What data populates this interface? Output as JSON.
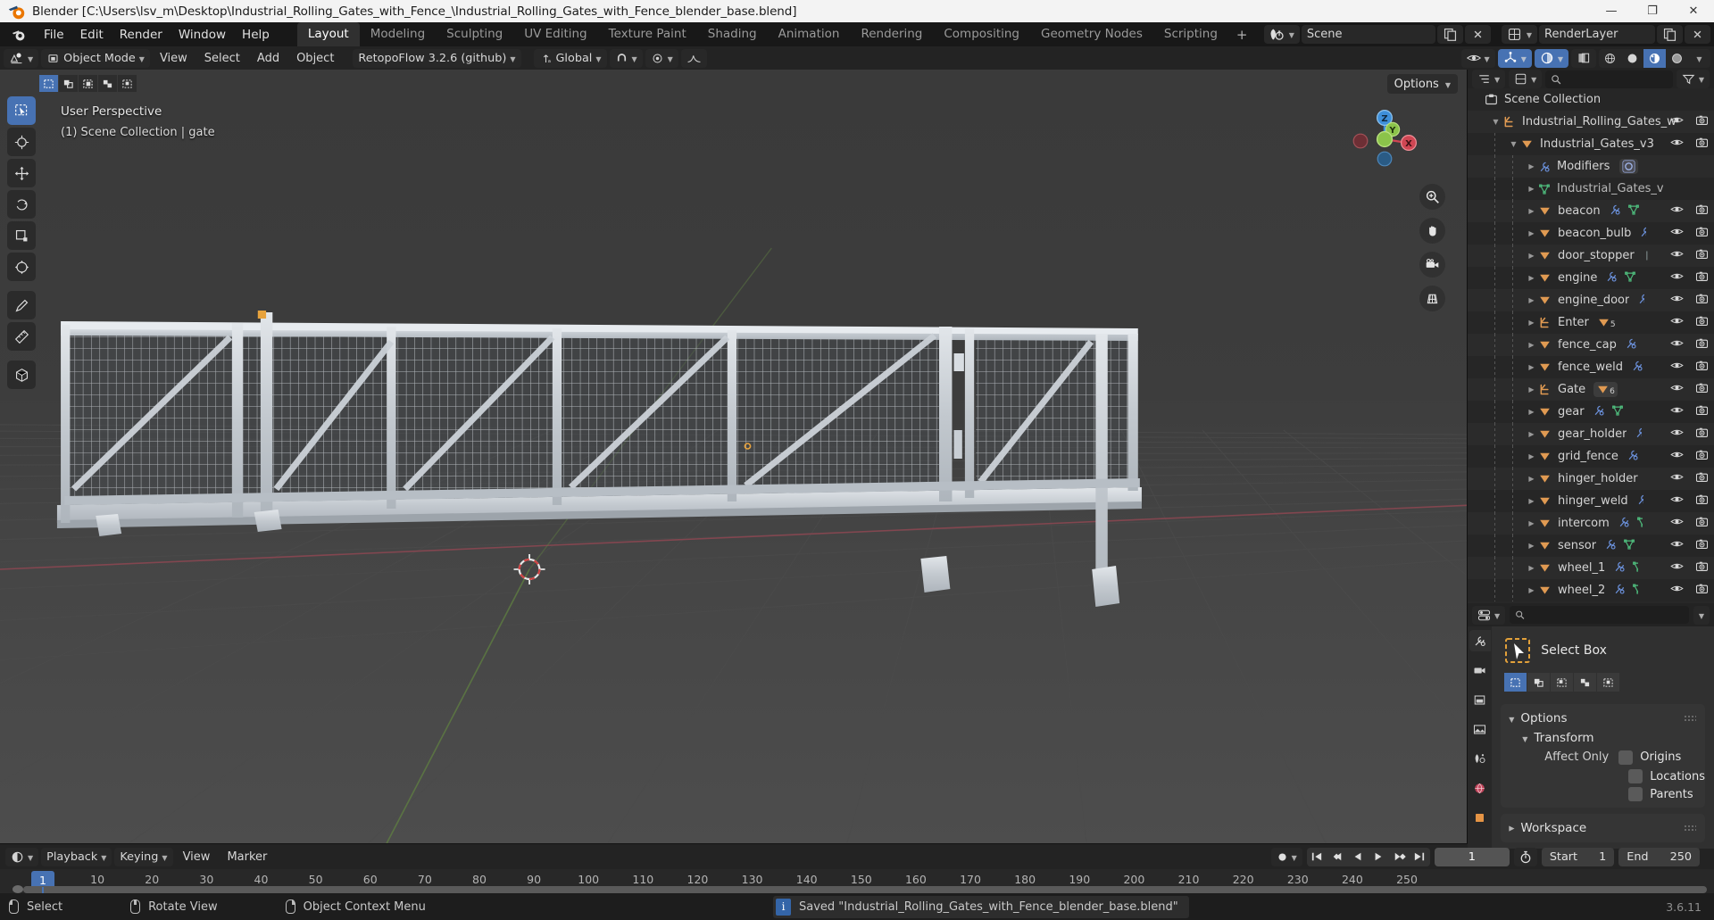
{
  "window": {
    "title": "Blender [C:\\Users\\lsv_m\\Desktop\\Industrial_Rolling_Gates_with_Fence_\\Industrial_Rolling_Gates_with_Fence_blender_base.blend]",
    "minimize": "—",
    "maximize": "❐",
    "close": "✕"
  },
  "topbar": {
    "menus": [
      "File",
      "Edit",
      "Render",
      "Window",
      "Help"
    ],
    "workspaces": [
      "Layout",
      "Modeling",
      "Sculpting",
      "UV Editing",
      "Texture Paint",
      "Shading",
      "Animation",
      "Rendering",
      "Compositing",
      "Geometry Nodes",
      "Scripting"
    ],
    "active_workspace": "Layout",
    "add_workspace": "+",
    "scene_name": "Scene",
    "viewlayer_name": "RenderLayer"
  },
  "viewport_header": {
    "mode": "Object Mode",
    "menus": [
      "View",
      "Select",
      "Add",
      "Object"
    ],
    "addon": "RetopoFlow 3.2.6 (github)",
    "transform_orientation": "Global"
  },
  "viewport": {
    "perspective_label": "User Perspective",
    "collection_label": "(1) Scene Collection | gate",
    "options_label": "Options",
    "gizmo_axes": [
      "X",
      "Y",
      "Z"
    ],
    "nav_icons": [
      "zoom-icon",
      "pan-hand-icon",
      "camera-icon",
      "grid-perspective-icon"
    ]
  },
  "outliner": {
    "scene_collection": "Scene Collection",
    "rows": [
      {
        "label": "Industrial_Rolling_Gates_w",
        "indent": 1,
        "type": "collection",
        "disclosure": "down",
        "eye": true,
        "camera": true,
        "extra": []
      },
      {
        "label": "Industrial_Gates_v3",
        "indent": 2,
        "type": "object",
        "disclosure": "down",
        "eye": true,
        "camera": true,
        "extra": []
      },
      {
        "label": "Modifiers",
        "indent": 3,
        "type": "modifier",
        "disclosure": "right",
        "eye": false,
        "camera": false,
        "extra": [
          "badge-modifier"
        ]
      },
      {
        "label": "Industrial_Gates_v",
        "indent": 3,
        "type": "mesh",
        "disclosure": "right",
        "eye": false,
        "camera": false,
        "extra": []
      },
      {
        "label": "beacon",
        "indent": 3,
        "type": "object",
        "disclosure": "right",
        "eye": true,
        "camera": true,
        "extra": [
          "wrench",
          "mesh"
        ]
      },
      {
        "label": "beacon_bulb",
        "indent": 3,
        "type": "object",
        "disclosure": "right",
        "eye": true,
        "camera": true,
        "extra": [
          "wrench-partial"
        ]
      },
      {
        "label": "door_stopper",
        "indent": 3,
        "type": "object",
        "disclosure": "right",
        "eye": true,
        "camera": true,
        "extra": [
          "tiny"
        ]
      },
      {
        "label": "engine",
        "indent": 3,
        "type": "object",
        "disclosure": "right",
        "eye": true,
        "camera": true,
        "extra": [
          "wrench",
          "mesh"
        ]
      },
      {
        "label": "engine_door",
        "indent": 3,
        "type": "object",
        "disclosure": "right",
        "eye": true,
        "camera": true,
        "extra": [
          "wrench-partial"
        ]
      },
      {
        "label": "Enter",
        "indent": 3,
        "type": "collection",
        "disclosure": "right",
        "eye": true,
        "camera": true,
        "extra": [
          "count-5"
        ]
      },
      {
        "label": "fence_cap",
        "indent": 3,
        "type": "object",
        "disclosure": "right",
        "eye": true,
        "camera": true,
        "extra": [
          "wrench"
        ]
      },
      {
        "label": "fence_weld",
        "indent": 3,
        "type": "object",
        "disclosure": "right",
        "eye": true,
        "camera": true,
        "extra": [
          "wrench"
        ]
      },
      {
        "label": "Gate",
        "indent": 3,
        "type": "collection",
        "disclosure": "right",
        "eye": true,
        "camera": true,
        "extra": [
          "badge-count-6"
        ]
      },
      {
        "label": "gear",
        "indent": 3,
        "type": "object",
        "disclosure": "right",
        "eye": true,
        "camera": true,
        "extra": [
          "wrench",
          "mesh"
        ]
      },
      {
        "label": "gear_holder",
        "indent": 3,
        "type": "object",
        "disclosure": "right",
        "eye": true,
        "camera": true,
        "extra": [
          "wrench-partial"
        ]
      },
      {
        "label": "grid_fence",
        "indent": 3,
        "type": "object",
        "disclosure": "right",
        "eye": true,
        "camera": true,
        "extra": [
          "wrench"
        ]
      },
      {
        "label": "hinger_holder",
        "indent": 3,
        "type": "object",
        "disclosure": "right",
        "eye": true,
        "camera": true,
        "extra": []
      },
      {
        "label": "hinger_weld",
        "indent": 3,
        "type": "object",
        "disclosure": "right",
        "eye": true,
        "camera": true,
        "extra": [
          "wrench-partial"
        ]
      },
      {
        "label": "intercom",
        "indent": 3,
        "type": "object",
        "disclosure": "right",
        "eye": true,
        "camera": true,
        "extra": [
          "wrench",
          "mesh-partial"
        ]
      },
      {
        "label": "sensor",
        "indent": 3,
        "type": "object",
        "disclosure": "right",
        "eye": true,
        "camera": true,
        "extra": [
          "wrench",
          "mesh"
        ]
      },
      {
        "label": "wheel_1",
        "indent": 3,
        "type": "object",
        "disclosure": "right",
        "eye": true,
        "camera": true,
        "extra": [
          "wrench",
          "mesh-partial"
        ]
      },
      {
        "label": "wheel_2",
        "indent": 3,
        "type": "object",
        "disclosure": "right",
        "eye": true,
        "camera": true,
        "extra": [
          "wrench",
          "mesh-partial"
        ]
      }
    ]
  },
  "properties": {
    "search_placeholder": "",
    "tool_name": "Select Box",
    "select_modes": [
      "set-mode",
      "extend-mode",
      "subtract-mode",
      "invert-mode",
      "intersect-mode"
    ],
    "active_select_mode": 0,
    "panels": {
      "options_label": "Options",
      "transform_label": "Transform",
      "affect_only_label": "Affect Only",
      "affect_only_items": [
        "Origins",
        "Locations",
        "Parents"
      ],
      "workspace_label": "Workspace"
    }
  },
  "timeline": {
    "menus": [
      "Playback",
      "Keying",
      "View",
      "Marker"
    ],
    "current_frame": "1",
    "start_label": "Start",
    "start_value": "1",
    "end_label": "End",
    "end_value": "250",
    "ticks": [
      "1",
      "10",
      "20",
      "30",
      "40",
      "50",
      "60",
      "70",
      "80",
      "90",
      "100",
      "110",
      "120",
      "130",
      "140",
      "150",
      "160",
      "170",
      "180",
      "190",
      "200",
      "210",
      "220",
      "230",
      "240",
      "250"
    ],
    "playhead_frame": "1"
  },
  "statusbar": {
    "items": [
      {
        "icon": "mouse-left-icon",
        "label": "Select"
      },
      {
        "icon": "mouse-middle-icon",
        "label": "Rotate View"
      },
      {
        "icon": "mouse-right-icon",
        "label": "Object Context Menu"
      }
    ],
    "message": "Saved \"Industrial_Rolling_Gates_with_Fence_blender_base.blend\"",
    "version": "3.6.11"
  },
  "colors": {
    "accent_blue": "#4772b3",
    "collection_orange": "#e09a52",
    "mesh_green": "#4ebb7c",
    "modifier_blue": "#6a8fd8",
    "axis_x": "#cf4653",
    "axis_y": "#8bc34a",
    "axis_z": "#3e8fd9",
    "info_blue": "#3465a8",
    "panel_bg": "#303030"
  }
}
